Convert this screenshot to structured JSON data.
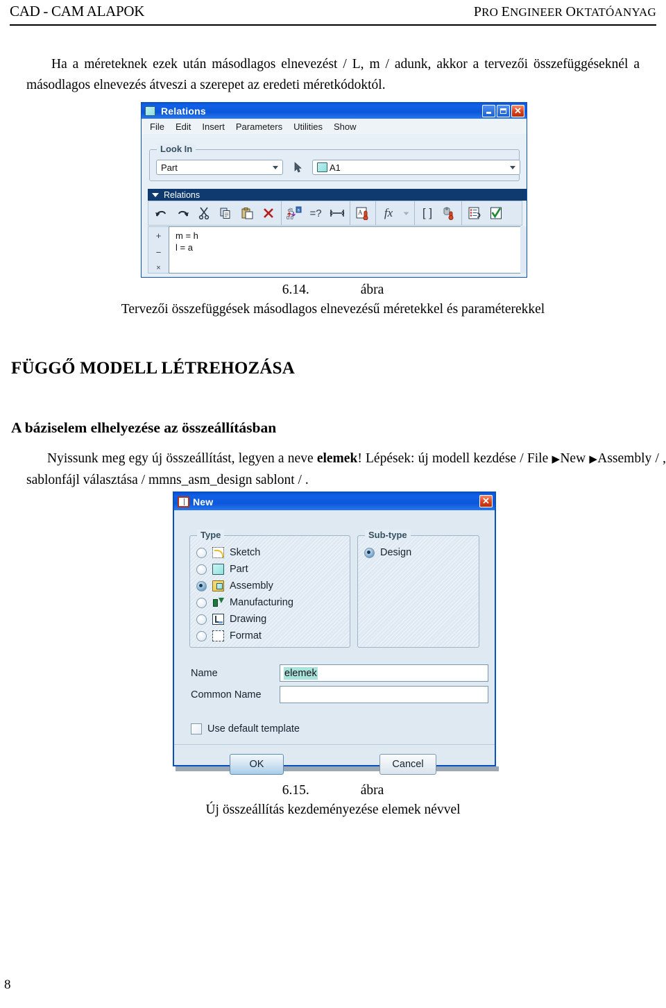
{
  "page": {
    "header_left": "CAD - CAM ALAPOK",
    "header_right_1": "P",
    "header_right_2": "RO ",
    "header_right_3": "E",
    "header_right_4": "NGINEER ",
    "header_right_5": "O",
    "header_right_6": "KTATÓANYAG",
    "number": "8"
  },
  "paragraphs": {
    "intro": "Ha a méreteknek ezek után másodlagos elnevezést / L, m / adunk, akkor a tervezői összefüggéseknél a másodlagos elnevezés átveszi a szerepet az eredeti méretkódoktól.",
    "heading_1": "FÜGGŐ MODELL LÉTREHOZÁSA",
    "heading_2": "A báziselem elhelyezése az összeállításban",
    "steps_1": "Nyissunk meg egy új összeállítást, legyen a neve ",
    "steps_bold": "elemek",
    "steps_2": "! Lépések: új modell kezdése / File ",
    "steps_tri1": "▶",
    "steps_3": "New ",
    "steps_tri2": "▶",
    "steps_4": "Assembly / , sablonfájl választása / mmns_asm_design sablont / ."
  },
  "figure_614": {
    "number": "6.14.",
    "word": "ábra",
    "text": "Tervezői összefüggések másodlagos elnevezésű méretekkel és paraméterekkel"
  },
  "figure_615": {
    "number": "6.15.",
    "word": "ábra",
    "text": "Új összeállítás kezdeményezése elemek névvel"
  },
  "relations_window": {
    "title": "Relations",
    "menus": [
      "File",
      "Edit",
      "Insert",
      "Parameters",
      "Utilities",
      "Show"
    ],
    "look_in": {
      "group_label": "Look In",
      "scope_value": "Part",
      "object_value": "A1"
    },
    "section_label": "Relations",
    "toolbar": [
      {
        "name": "undo-icon",
        "glyph": "↰"
      },
      {
        "name": "redo-icon",
        "glyph": "↱"
      },
      {
        "name": "cut-icon",
        "glyph": "✂"
      },
      {
        "name": "copy-icon",
        "glyph": "⧉"
      },
      {
        "name": "paste-icon",
        "glyph": "📋"
      },
      {
        "name": "delete-icon",
        "glyph": "✕"
      },
      {
        "name": "switch-dimensions-icon",
        "glyph": "d1"
      },
      {
        "name": "evaluate-icon",
        "glyph": "=?"
      },
      {
        "name": "dimension-span-icon",
        "glyph": "↔"
      },
      {
        "name": "local-parameters-icon",
        "glyph": "A"
      },
      {
        "name": "functions-icon",
        "glyph": "fx"
      },
      {
        "name": "brackets-icon",
        "glyph": "[ ]"
      },
      {
        "name": "units-icon",
        "glyph": "⚗"
      },
      {
        "name": "relation-list-icon",
        "glyph": "☰"
      },
      {
        "name": "verify-icon",
        "glyph": "✔"
      }
    ],
    "gutter": [
      "+",
      "−",
      "×"
    ],
    "editor_lines": [
      "m = h",
      "l = a"
    ],
    "title_buttons": {
      "minimize": "minimize-button",
      "maximize": "maximize-button",
      "close": "close-button"
    }
  },
  "new_dialog": {
    "title": "New",
    "type_group_label": "Type",
    "subtype_group_label": "Sub-type",
    "types": [
      {
        "label": "Sketch",
        "icon": "sketch-icon",
        "selected": false
      },
      {
        "label": "Part",
        "icon": "part-icon",
        "selected": false
      },
      {
        "label": "Assembly",
        "icon": "assembly-icon",
        "selected": true
      },
      {
        "label": "Manufacturing",
        "icon": "manufacturing-icon",
        "selected": false
      },
      {
        "label": "Drawing",
        "icon": "drawing-icon",
        "selected": false
      },
      {
        "label": "Format",
        "icon": "format-icon",
        "selected": false
      }
    ],
    "subtypes": [
      {
        "label": "Design",
        "selected": true
      }
    ],
    "name_label": "Name",
    "name_value": "elemek",
    "common_name_label": "Common Name",
    "common_name_value": "",
    "default_template_label": "Use default template",
    "default_template_checked": false,
    "ok_label": "OK",
    "cancel_label": "Cancel"
  },
  "colors": {
    "titlebar_blue": "#0c57d9",
    "close_red": "#d8421a",
    "selection_teal": "#a8e3dc",
    "dialog_face": "#dfe9f2",
    "section_header": "#0f3a70"
  }
}
